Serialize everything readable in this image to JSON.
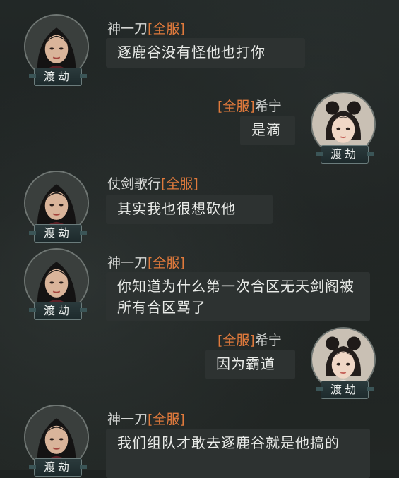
{
  "chat": {
    "messages": [
      {
        "sender": "神一刀",
        "channel": "[全服]",
        "text": "逐鹿谷没有怪他也打你",
        "avatar_label": "渡劫",
        "side": "left"
      },
      {
        "sender": "希宁",
        "channel": "[全服]",
        "text": "是滴",
        "avatar_label": "渡劫",
        "side": "right"
      },
      {
        "sender": "仗剑歌行",
        "channel": "[全服]",
        "text": "其实我也很想砍他",
        "avatar_label": "渡劫",
        "side": "left"
      },
      {
        "sender": "神一刀",
        "channel": "[全服]",
        "text": "你知道为什么第一次合区无天剑阁被所有合区骂了",
        "avatar_label": "渡劫",
        "side": "left"
      },
      {
        "sender": "希宁",
        "channel": "[全服]",
        "text": "因为霸道",
        "avatar_label": "渡劫",
        "side": "right"
      },
      {
        "sender": "神一刀",
        "channel": "[全服]",
        "text": "我们组队才敢去逐鹿谷就是他搞的",
        "avatar_label": "渡劫",
        "side": "left"
      }
    ]
  },
  "colors": {
    "background": "#1f2322",
    "bubble": "#2d3231",
    "channel_tag": "#e07a3c",
    "sender_name": "#d4d6d4"
  },
  "icons": {
    "left_avatar": "female-cultivator-portrait",
    "right_avatar": "girl-twin-buns-portrait"
  }
}
